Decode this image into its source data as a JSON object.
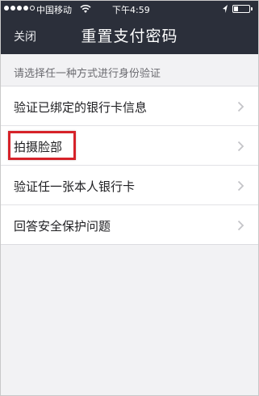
{
  "status_bar": {
    "carrier": "中国移动",
    "time": "下午4:59",
    "signal_filled": 4,
    "signal_total": 5
  },
  "nav": {
    "close_label": "关闭",
    "title": "重置支付密码"
  },
  "hint": "请选择任一种方式进行身份验证",
  "options": [
    {
      "label": "验证已绑定的银行卡信息"
    },
    {
      "label": "拍摄脸部",
      "highlighted": true
    },
    {
      "label": "验证任一张本人银行卡"
    },
    {
      "label": "回答安全保护问题"
    }
  ],
  "colors": {
    "header_bg": "#2b2f3a",
    "page_bg": "#f2f2f4",
    "highlight_border": "#d62229"
  }
}
